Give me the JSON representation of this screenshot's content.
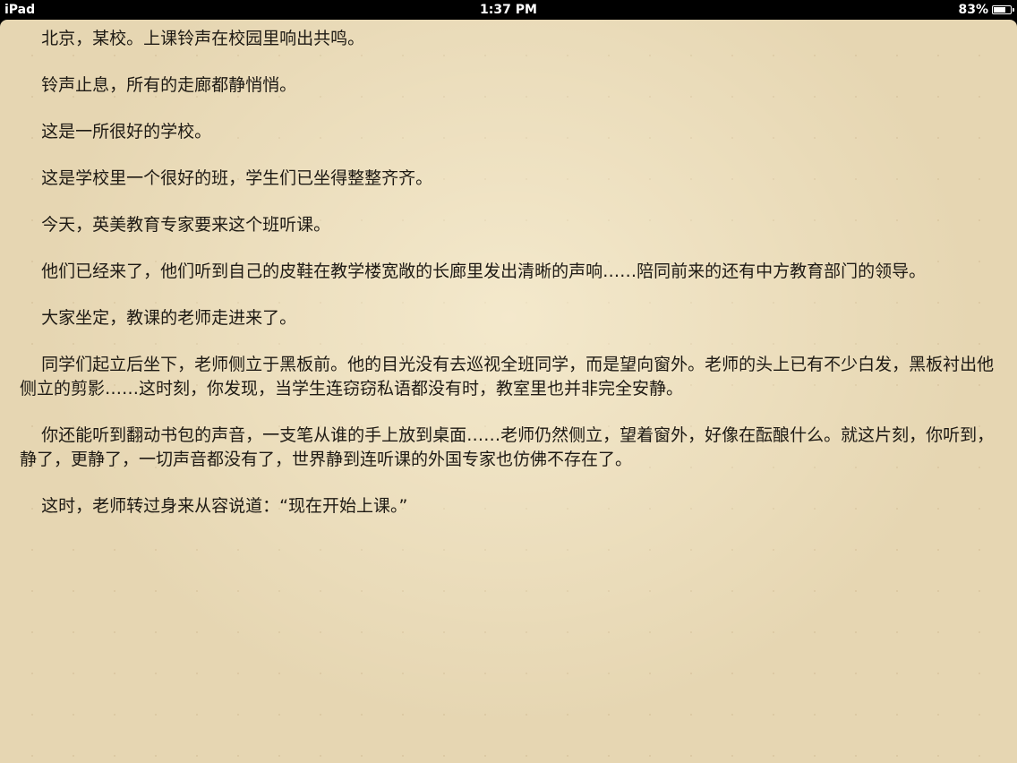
{
  "status_bar": {
    "device": "iPad",
    "time": "1:37 PM",
    "battery_text": "83%",
    "battery_level": 0.83
  },
  "book": {
    "paragraphs": [
      "北京，某校。上课铃声在校园里响出共鸣。",
      "铃声止息，所有的走廊都静悄悄。",
      "这是一所很好的学校。",
      "这是学校里一个很好的班，学生们已坐得整整齐齐。",
      "今天，英美教育专家要来这个班听课。",
      "他们已经来了，他们听到自己的皮鞋在教学楼宽敞的长廊里发出清晰的声响……陪同前来的还有中方教育部门的领导。",
      "大家坐定，教课的老师走进来了。",
      "同学们起立后坐下，老师侧立于黑板前。他的目光没有去巡视全班同学，而是望向窗外。老师的头上已有不少白发，黑板衬出他侧立的剪影……这时刻，你发现，当学生连窃窃私语都没有时，教室里也并非完全安静。",
      "你还能听到翻动书包的声音，一支笔从谁的手上放到桌面……老师仍然侧立，望着窗外，好像在酝酿什么。就这片刻，你听到，静了，更静了，一切声音都没有了，世界静到连听课的外国专家也仿佛不存在了。",
      "这时，老师转过身来从容说道：“现在开始上课。”"
    ]
  }
}
